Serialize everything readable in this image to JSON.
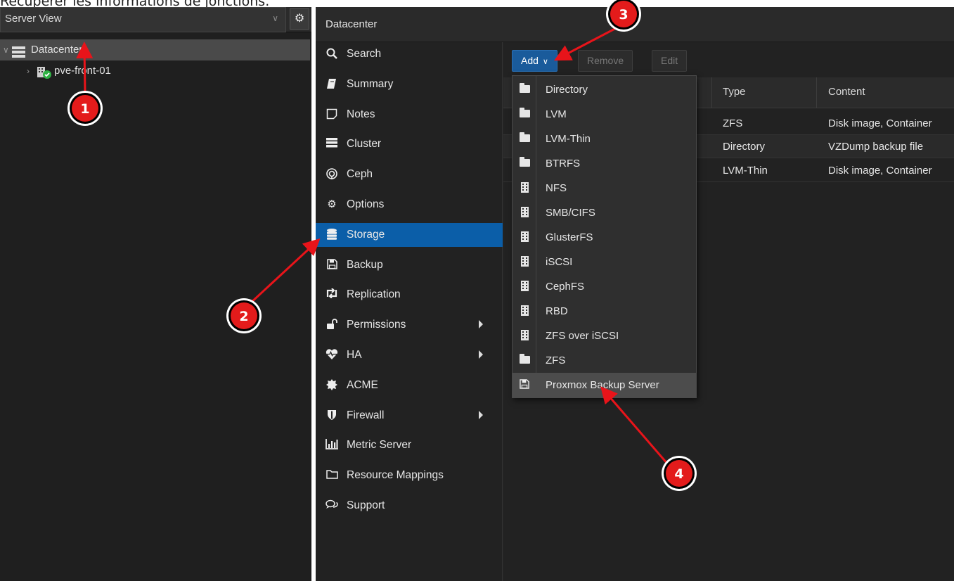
{
  "caption": "Récupérer les informations de jonctions.",
  "tree": {
    "view_label": "Server View",
    "datacenter": "Datacenter",
    "node": "pve-front-01"
  },
  "header": {
    "title": "Datacenter"
  },
  "nav": {
    "items": [
      {
        "label": "Search",
        "icon": "search-icon"
      },
      {
        "label": "Summary",
        "icon": "book-icon"
      },
      {
        "label": "Notes",
        "icon": "note-icon"
      },
      {
        "label": "Cluster",
        "icon": "server-icon"
      },
      {
        "label": "Ceph",
        "icon": "ceph-icon"
      },
      {
        "label": "Options",
        "icon": "gear-icon"
      },
      {
        "label": "Storage",
        "icon": "database-icon",
        "active": true
      },
      {
        "label": "Backup",
        "icon": "floppy-icon"
      },
      {
        "label": "Replication",
        "icon": "retweet-icon"
      },
      {
        "label": "Permissions",
        "icon": "unlock-icon",
        "submenu": true
      },
      {
        "label": "HA",
        "icon": "heartbeat-icon",
        "submenu": true
      },
      {
        "label": "ACME",
        "icon": "certificate-icon"
      },
      {
        "label": "Firewall",
        "icon": "shield-icon",
        "submenu": true
      },
      {
        "label": "Metric Server",
        "icon": "bar-chart-icon"
      },
      {
        "label": "Resource Mappings",
        "icon": "folder-open-icon"
      },
      {
        "label": "Support",
        "icon": "comments-icon"
      }
    ]
  },
  "toolbar": {
    "add": "Add",
    "remove": "Remove",
    "edit": "Edit"
  },
  "grid": {
    "headers": {
      "type": "Type",
      "content": "Content"
    },
    "rows": [
      {
        "type": "ZFS",
        "content": "Disk image, Container"
      },
      {
        "type": "Directory",
        "content": "VZDump backup file"
      },
      {
        "type": "LVM-Thin",
        "content": "Disk image, Container"
      }
    ]
  },
  "add_menu": {
    "items": [
      {
        "label": "Directory",
        "icon": "folder-icon"
      },
      {
        "label": "LVM",
        "icon": "folder-icon"
      },
      {
        "label": "LVM-Thin",
        "icon": "folder-icon"
      },
      {
        "label": "BTRFS",
        "icon": "folder-icon"
      },
      {
        "label": "NFS",
        "icon": "building-icon"
      },
      {
        "label": "SMB/CIFS",
        "icon": "building-icon"
      },
      {
        "label": "GlusterFS",
        "icon": "building-icon"
      },
      {
        "label": "iSCSI",
        "icon": "building-icon"
      },
      {
        "label": "CephFS",
        "icon": "building-icon"
      },
      {
        "label": "RBD",
        "icon": "building-icon"
      },
      {
        "label": "ZFS over iSCSI",
        "icon": "building-icon"
      },
      {
        "label": "ZFS",
        "icon": "folder-icon"
      },
      {
        "label": "Proxmox Backup Server",
        "icon": "floppy-icon",
        "highlighted": true
      }
    ]
  },
  "annotations": {
    "markers": [
      "1",
      "2",
      "3",
      "4"
    ],
    "arrow_color": "#e8141a"
  },
  "colors": {
    "accent": "#0b5ea8",
    "badge_red": "#e31b1b",
    "status_green": "#2fb344"
  }
}
